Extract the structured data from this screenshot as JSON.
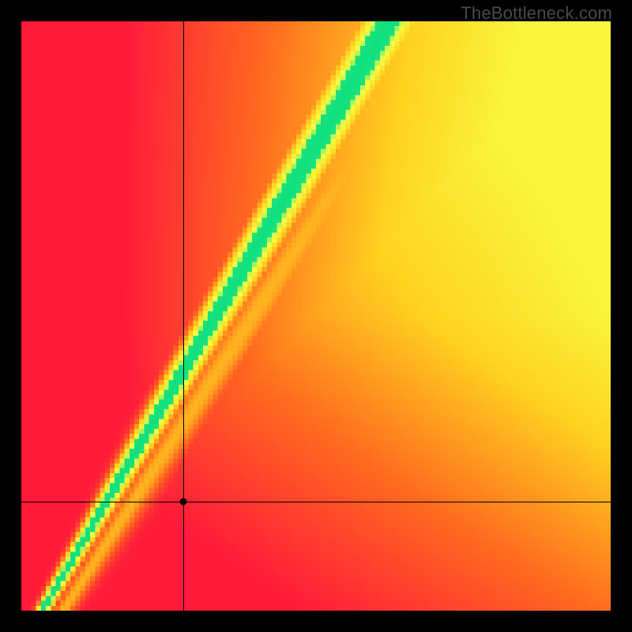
{
  "watermark": "TheBottleneck.com",
  "chart_data": {
    "type": "heatmap",
    "title": "",
    "xlabel": "",
    "ylabel": "",
    "xlim": [
      0,
      1
    ],
    "ylim": [
      0,
      1
    ],
    "grid_resolution": 120,
    "colorscale": [
      {
        "stop": 0.0,
        "color": "#ff1a3a"
      },
      {
        "stop": 0.25,
        "color": "#ff6a1f"
      },
      {
        "stop": 0.5,
        "color": "#ffd21f"
      },
      {
        "stop": 0.75,
        "color": "#f7ff45"
      },
      {
        "stop": 1.0,
        "color": "#10e080"
      }
    ],
    "optimal_line": {
      "slope": 1.7,
      "intercept": -0.06,
      "description": "Ridge of optimal (green) values; y/x well above 1"
    },
    "crosshair": {
      "x": 0.275,
      "y": 0.185
    },
    "marker": {
      "x": 0.275,
      "y": 0.185
    },
    "value_at_marker_estimate": 0.45
  },
  "colors": {
    "background": "#000000",
    "watermark": "#4a4a4a"
  }
}
